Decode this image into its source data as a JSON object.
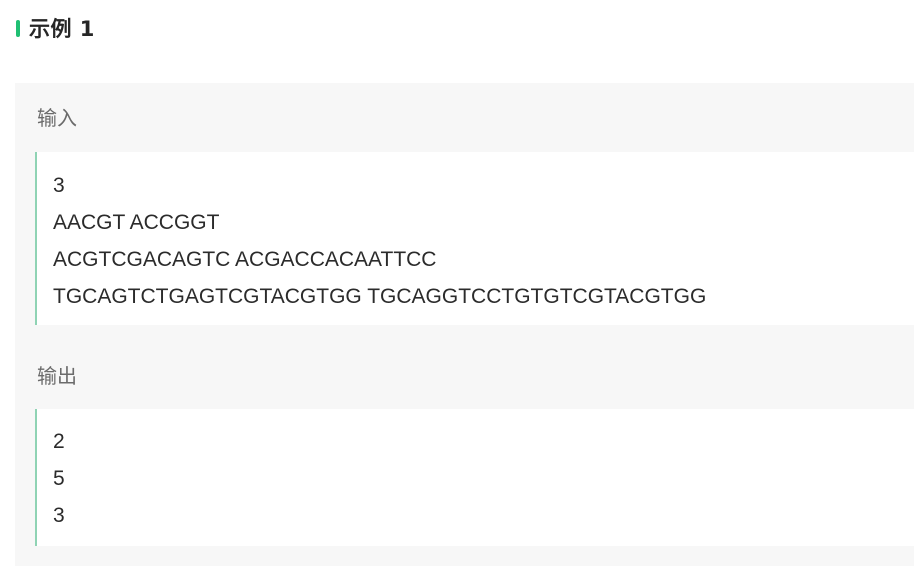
{
  "example": {
    "title": "示例 1",
    "accent_color": "#1fbf73",
    "input": {
      "label": "输入",
      "lines": [
        "3",
        "AACGT ACCGGT",
        "ACGTCGACAGTC ACGACCACAATTCC",
        "TGCAGTCTGAGTCGTACGTGG TGCAGGTCCTGTGTCGTACGTGG"
      ]
    },
    "output": {
      "label": "输出",
      "lines": [
        "2",
        "5",
        "3"
      ]
    }
  }
}
